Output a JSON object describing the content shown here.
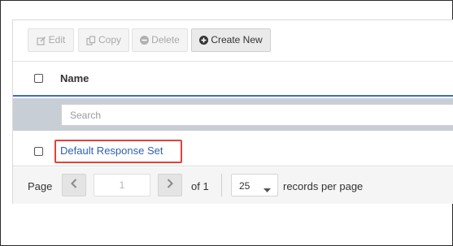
{
  "toolbar": {
    "edit_label": "Edit",
    "copy_label": "Copy",
    "delete_label": "Delete",
    "create_label": "Create New"
  },
  "table": {
    "column_name": "Name",
    "search_placeholder": "Search",
    "rows": [
      {
        "name": "Default Response Set"
      }
    ]
  },
  "pagination": {
    "page_label": "Page",
    "current_page": "1",
    "of_label": "of 1",
    "page_size": "25",
    "records_label": "records per page"
  },
  "icons": {
    "edit": "edit-icon",
    "copy": "copy-icon",
    "delete": "minus-circle-icon",
    "create": "plus-circle-icon",
    "prev": "chevron-left-icon",
    "next": "chevron-right-icon",
    "dropdown": "caret-down-icon"
  },
  "colors": {
    "link": "#2f5fb3",
    "header_underline": "#3d6fb6",
    "filter_row_bg": "#c8ced6",
    "highlight": "#e0433a"
  }
}
